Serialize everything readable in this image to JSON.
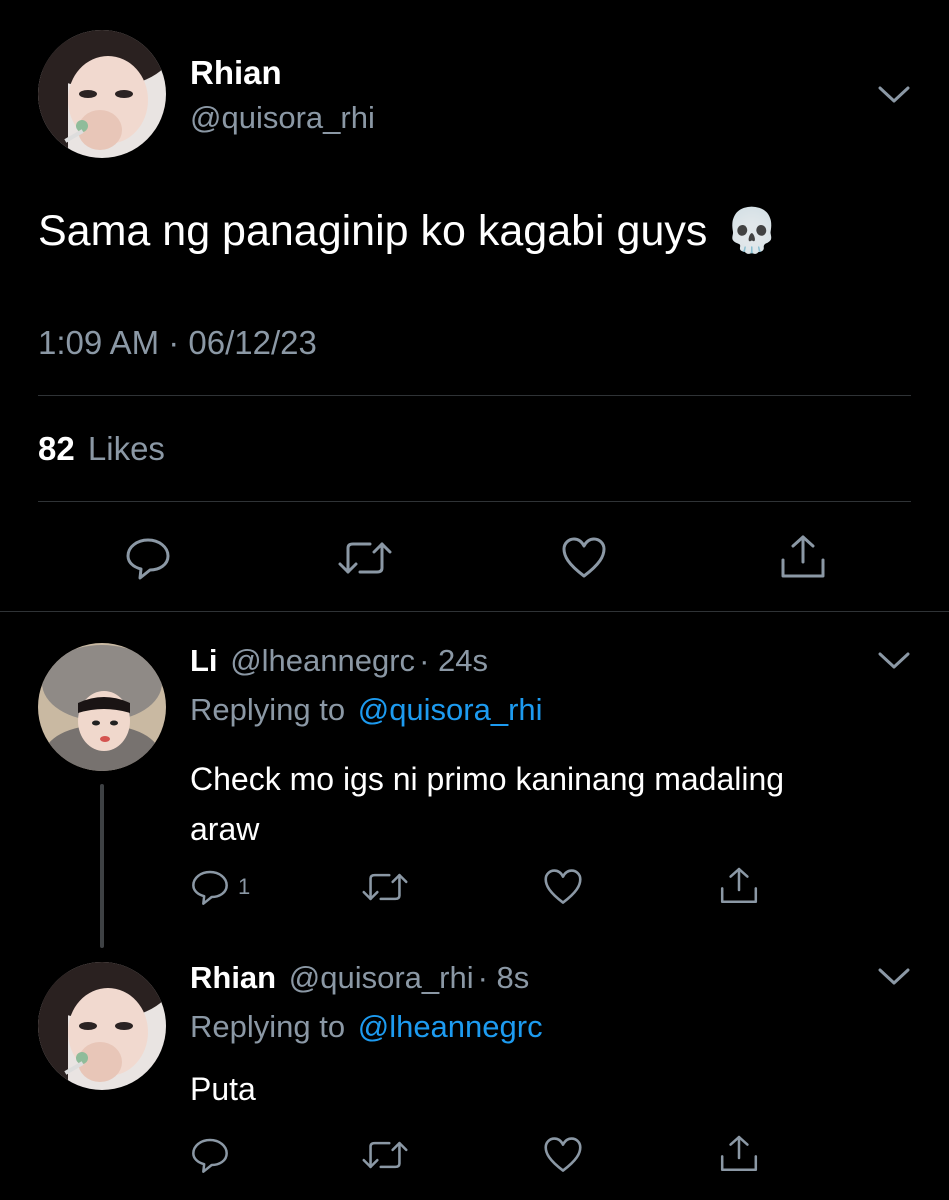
{
  "main_tweet": {
    "author_name": "Rhian",
    "handle": "@quisora_rhi",
    "text": "Sama ng panaginip ko kagabi guys",
    "emoji": "💀",
    "timestamp": "1:09 AM · 06/12/23",
    "likes_count": "82",
    "likes_label": "Likes"
  },
  "replies": [
    {
      "author_name": "Li",
      "handle": "@lheannegrc",
      "age": "· 24s",
      "replying_prefix": "Replying to",
      "replying_to": "@quisora_rhi",
      "text_line1": "Check mo igs ni primo kaninang madaling",
      "text_line2": "araw",
      "reply_count": "1"
    },
    {
      "author_name": "Rhian",
      "handle": "@quisora_rhi",
      "age": "· 8s",
      "replying_prefix": "Replying to",
      "replying_to": "@lheannegrc",
      "text": "Puta"
    }
  ],
  "icons": [
    "chevron-down-icon",
    "reply-icon",
    "retweet-icon",
    "like-icon",
    "share-icon"
  ],
  "colors": {
    "background": "#000000",
    "text": "#ffffff",
    "muted": "#8b98a5",
    "link": "#1d9bf0",
    "divider": "#2f3336"
  }
}
